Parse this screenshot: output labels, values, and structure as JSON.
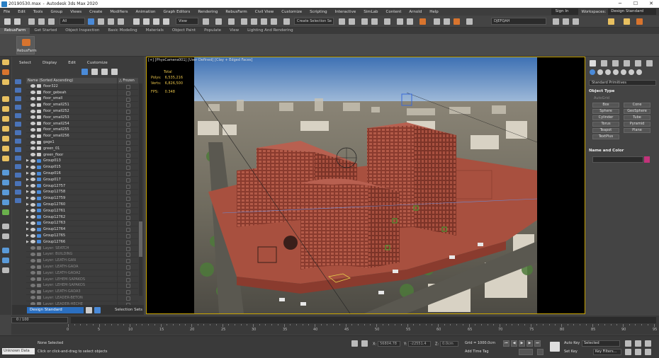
{
  "title": {
    "file": "20190530.max",
    "app": "Autodesk 3ds Max 2020"
  },
  "menu": [
    "File",
    "Edit",
    "Tools",
    "Group",
    "Views",
    "Create",
    "Modifiers",
    "Animation",
    "Graph Editors",
    "Rendering",
    "RebusFarm",
    "Civil View",
    "Customize",
    "Scripting",
    "Interactive",
    "SimLab",
    "Content",
    "Arnold",
    "Help"
  ],
  "signin": "Sign In",
  "workspace_label": "Workspaces:",
  "workspace": "Design Standard",
  "toolbar": {
    "filter": "All",
    "view": "View",
    "selset": "Create Selection Se",
    "camera": "DJEFQAH"
  },
  "ribbon_tabs": [
    "RebusFarm",
    "Get Started",
    "Object Inspection",
    "Basic Modeling",
    "Materials",
    "Object Paint",
    "Populate",
    "View",
    "Lighting And Rendering"
  ],
  "ribbon_btn": "RebusFarm",
  "explorer": {
    "menu": [
      "Select",
      "Display",
      "Edit",
      "Customize"
    ],
    "col_name": "Name (Sorted Ascending)",
    "col_frozen": "△ Frozen",
    "rows": [
      {
        "n": "floor322",
        "d": false,
        "a": "",
        "g": false
      },
      {
        "n": "floor_gebeah",
        "d": false,
        "a": "",
        "g": false
      },
      {
        "n": "floor_small",
        "d": false,
        "a": "",
        "g": false
      },
      {
        "n": "floor_small251",
        "d": false,
        "a": "",
        "g": false
      },
      {
        "n": "floor_small252",
        "d": false,
        "a": "",
        "g": false
      },
      {
        "n": "floor_small253",
        "d": false,
        "a": "",
        "g": false
      },
      {
        "n": "floor_small254",
        "d": false,
        "a": "",
        "g": false
      },
      {
        "n": "floor_small255",
        "d": false,
        "a": "",
        "g": false
      },
      {
        "n": "floor_small256",
        "d": false,
        "a": "",
        "g": false
      },
      {
        "n": "gage1",
        "d": false,
        "a": "",
        "g": false
      },
      {
        "n": "green_01",
        "d": false,
        "a": "",
        "g": false
      },
      {
        "n": "green_floor",
        "d": false,
        "a": "",
        "g": false
      },
      {
        "n": "Group013",
        "d": false,
        "a": "▶",
        "g": true
      },
      {
        "n": "Group015",
        "d": false,
        "a": "▶",
        "g": true
      },
      {
        "n": "Group016",
        "d": false,
        "a": "▶",
        "g": true
      },
      {
        "n": "Group017",
        "d": false,
        "a": "▶",
        "g": true
      },
      {
        "n": "Group12757",
        "d": false,
        "a": "▶",
        "g": true
      },
      {
        "n": "Group12758",
        "d": false,
        "a": "▶",
        "g": true
      },
      {
        "n": "Group12759",
        "d": false,
        "a": "▶",
        "g": true
      },
      {
        "n": "Group12760",
        "d": false,
        "a": "▶",
        "g": true
      },
      {
        "n": "Group12761",
        "d": false,
        "a": "▶",
        "g": true
      },
      {
        "n": "Group12762",
        "d": false,
        "a": "▶",
        "g": true
      },
      {
        "n": "Group12763",
        "d": false,
        "a": "▶",
        "g": true
      },
      {
        "n": "Group12764",
        "d": false,
        "a": "▶",
        "g": true
      },
      {
        "n": "Group12765",
        "d": false,
        "a": "▶",
        "g": true
      },
      {
        "n": "Group12766",
        "d": false,
        "a": "▶",
        "g": true
      },
      {
        "n": "Layer: SEATCH",
        "d": true,
        "a": "",
        "g": false
      },
      {
        "n": "Layer: BUILDING",
        "d": true,
        "a": "",
        "g": false
      },
      {
        "n": "Layer: LEATH-GAN",
        "d": true,
        "a": "",
        "g": false
      },
      {
        "n": "Layer: LEATH-GADA",
        "d": true,
        "a": "",
        "g": false
      },
      {
        "n": "Layer: LEATH-GADA2",
        "d": true,
        "a": "",
        "g": false
      },
      {
        "n": "Layer: LEHEM-SAPAKOS",
        "d": true,
        "a": "",
        "g": false
      },
      {
        "n": "Layer: LEHEM-SAPAKOS",
        "d": true,
        "a": "",
        "g": false
      },
      {
        "n": "Layer: LEATH-GADA3",
        "d": true,
        "a": "",
        "g": false
      },
      {
        "n": "Layer: LEADER-BETON",
        "d": true,
        "a": "",
        "g": false
      },
      {
        "n": "Layer: LEADER-HECHE",
        "d": true,
        "a": "",
        "g": false
      },
      {
        "n": "Layer: LEHESH",
        "d": true,
        "a": "",
        "g": false
      }
    ],
    "footer_ws": "Design Standard",
    "footer_sel": "Selection Sets"
  },
  "viewport": {
    "label": "[+] [PhysCamera001] [User Defined] [Clay + Edged Faces]",
    "stats": {
      "total": "Total",
      "polys_l": "Polys:",
      "polys": "6,535,216",
      "verts_l": "Verts:",
      "verts": "6,826,500",
      "fps_l": "FPS:",
      "fps": "0.348"
    }
  },
  "command_panel": {
    "dropdown": "Standard Primitives",
    "object_type": "Object Type",
    "autogrid": "AutoGrid",
    "buttons": [
      "Box",
      "Cone",
      "Sphere",
      "GeoSphere",
      "Cylinder",
      "Tube",
      "Torus",
      "Pyramid",
      "Teapot",
      "Plane",
      "TextPlus"
    ],
    "name_color": "Name and Color",
    "swatch": "#c2337a"
  },
  "timeline": {
    "slider": "0 / 100",
    "ticks": [
      "0",
      "5",
      "10",
      "15",
      "20",
      "25",
      "30",
      "35",
      "40",
      "45",
      "50",
      "55",
      "60",
      "65",
      "70",
      "75",
      "80",
      "85",
      "90",
      "95",
      "100"
    ]
  },
  "status": {
    "maxscript": "Unknown Data",
    "line1": "None Selected",
    "line2": "Click or click-and-drag to select objects",
    "x_l": "X:",
    "x": "56804.78",
    "y_l": "Y:",
    "y": "-22551.4",
    "z_l": "Z:",
    "z": "0.0cm",
    "grid": "Grid = 1000.0cm",
    "add_time_tag": "Add Time Tag",
    "auto_key": "Auto Key",
    "selected": "Selected",
    "set_key": "Set Key",
    "key_filters": "Key Filters..."
  },
  "colors": {
    "building": "#a8503f",
    "ui_bg": "#444444",
    "accent": "#2b6fc0",
    "viewport_border": "#c8a400"
  }
}
